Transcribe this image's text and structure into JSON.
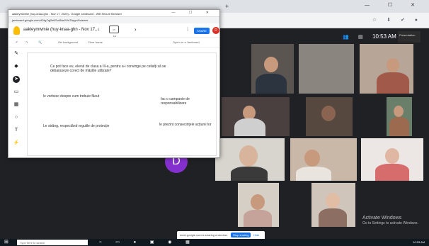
{
  "outer": {
    "plus": "+",
    "window_controls": "— ☐ ✕"
  },
  "meet": {
    "clock": "10:53 AM",
    "presenter_label": "Presentation",
    "d_avatar_letter": "D",
    "activate_title": "Activate Windows",
    "activate_sub": "Go to Settings to activate Windows.",
    "share_text": "meet.google.com is sharing a window.",
    "stop_sharing": "Stop sharing",
    "hide": "Hide",
    "colors": {
      "bg": "#202124",
      "avatar": "#8430ce",
      "accent": "#1a73e8"
    }
  },
  "jam": {
    "window_title": "aakleymwmie (huy-knaa-ghn - Nov 17, 2020) - Google Jamboard - Wifi Secure Browser",
    "window_controls": "— ☐ ✕",
    "url": "jamboard.google.com/d/1tg7qj2e6Gn4Nw2Ud7Aqyn9/viewer",
    "name": "aakleymwmie (huy-knaa-ghn - Nov 17,...",
    "frame_counter": "1/1",
    "next": "›",
    "more": "⋮",
    "share_label": "SHARE",
    "avatar_letter": "D",
    "toolbar": {
      "undo": "↶",
      "redo": "↷",
      "zoom": "🔍",
      "set_background": "Set background",
      "clear_frame": "Clear frame",
      "open_jamboard": "Open on a Jamboard"
    },
    "tools": [
      "pen",
      "eraser",
      "select",
      "sticky-note",
      "image",
      "circle",
      "text-box",
      "laser"
    ],
    "tool_glyphs": [
      "✎",
      "◆",
      "➤",
      "▭",
      "▦",
      "○",
      "T",
      "⚡"
    ],
    "notes": {
      "question": "Ce pot face eu, elevul de clasa a III-a, pentru a-i convinge pe ceilalți să se debaraseze corect de măștile utilizate?",
      "talk": "le vorbesc despre cum trebuie făcut",
      "campaign": "fac o campanie de responsabilizare",
      "rules": "Le strâng, respectând regulile de protecție",
      "consequences": "le prezint consecințele acțiunii lor"
    }
  },
  "taskbar": {
    "start": "⊞",
    "search_placeholder": "Type here to search",
    "tray_time": "10:53 AM"
  }
}
